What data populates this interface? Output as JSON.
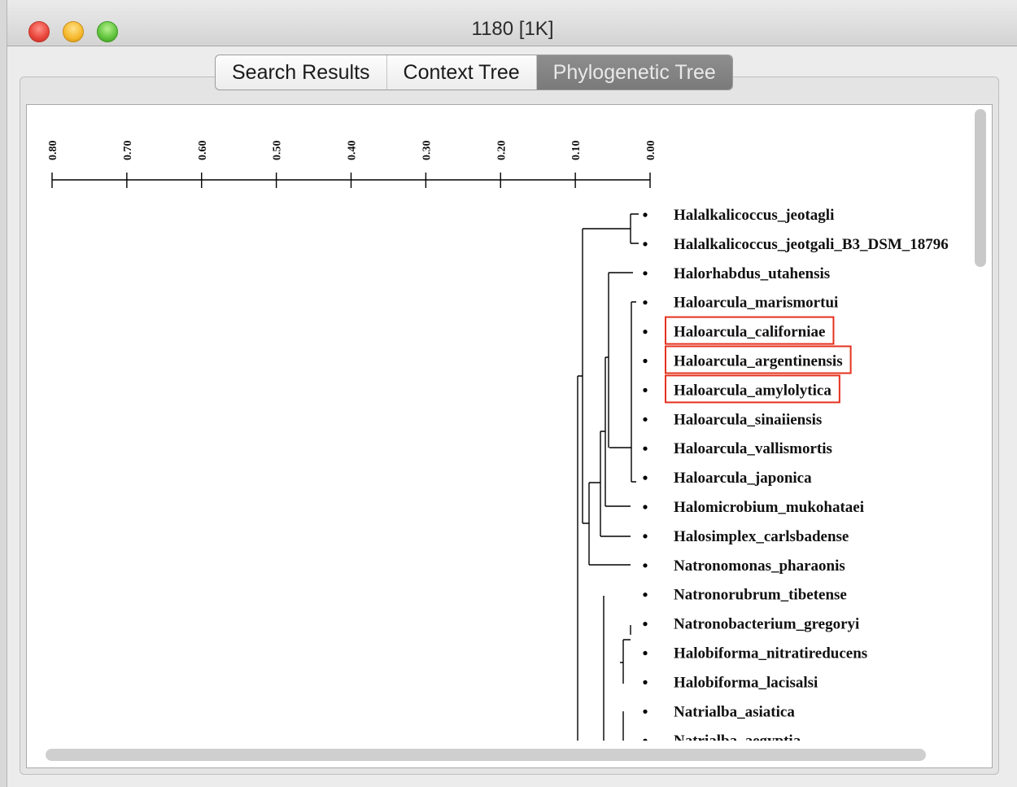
{
  "window": {
    "title": "1180 [1K]"
  },
  "tabs": [
    {
      "label": "Search Results",
      "active": false
    },
    {
      "label": "Context Tree",
      "active": false
    },
    {
      "label": "Phylogenetic Tree",
      "active": true
    }
  ],
  "scale": {
    "labels": [
      "0.80",
      "0.70",
      "0.60",
      "0.50",
      "0.40",
      "0.30",
      "0.20",
      "0.10",
      "0.00"
    ]
  },
  "taxa": [
    {
      "name": "Halalkalicoccus_jeotagli",
      "highlighted": false
    },
    {
      "name": "Halalkalicoccus_jeotgali_B3_DSM_18796",
      "highlighted": false
    },
    {
      "name": "Halorhabdus_utahensis",
      "highlighted": false
    },
    {
      "name": "Haloarcula_marismortui",
      "highlighted": false
    },
    {
      "name": "Haloarcula_californiae",
      "highlighted": true
    },
    {
      "name": "Haloarcula_argentinensis",
      "highlighted": true
    },
    {
      "name": "Haloarcula_amylolytica",
      "highlighted": true
    },
    {
      "name": "Haloarcula_sinaiiensis",
      "highlighted": false
    },
    {
      "name": "Haloarcula_vallismortis",
      "highlighted": false
    },
    {
      "name": "Haloarcula_japonica",
      "highlighted": false
    },
    {
      "name": "Halomicrobium_mukohataei",
      "highlighted": false
    },
    {
      "name": "Halosimplex_carlsbadense",
      "highlighted": false
    },
    {
      "name": "Natronomonas_pharaonis",
      "highlighted": false
    },
    {
      "name": "Natronorubrum_tibetense",
      "highlighted": false
    },
    {
      "name": "Natronobacterium_gregoryi",
      "highlighted": false
    },
    {
      "name": "Halobiforma_nitratireducens",
      "highlighted": false
    },
    {
      "name": "Halobiforma_lacisalsi",
      "highlighted": false
    },
    {
      "name": "Natrialba_asiatica",
      "highlighted": false
    },
    {
      "name": "Natrialba_aegyptia",
      "highlighted": false
    }
  ],
  "colors": {
    "highlight": "#e5321e",
    "active_tab": "#858585"
  }
}
